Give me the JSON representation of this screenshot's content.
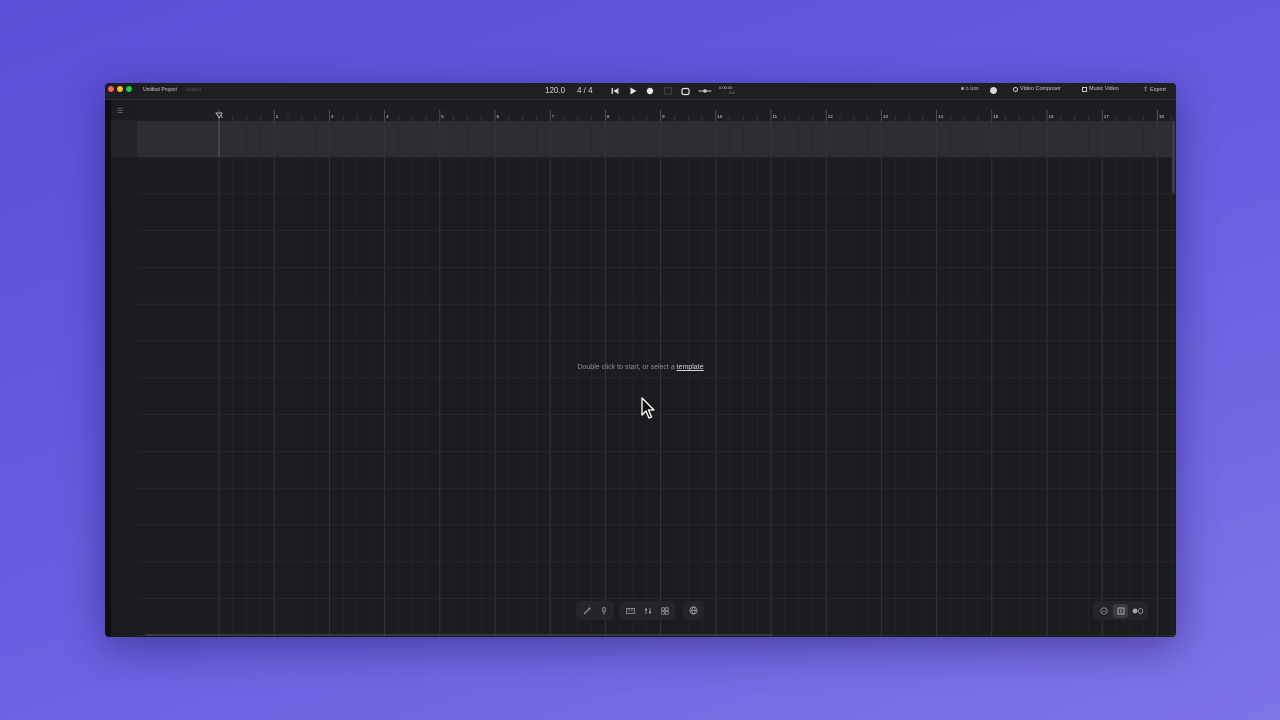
{
  "window": {
    "title": "Untitled Project",
    "subtitle": "Untitled"
  },
  "transport": {
    "tempo": "120.0",
    "time_signature": "4 / 4",
    "time_main": "0:00:00",
    "time_sub": "000",
    "icons": [
      "skip-back-icon",
      "play-icon",
      "record-icon",
      "metronome-icon",
      "loop-icon",
      "input-icon"
    ]
  },
  "header_right": {
    "status": "0 /100",
    "video_composer": "Video Composer",
    "music_video": "Music Video",
    "export": "Export"
  },
  "ruler": {
    "bars": [
      "1",
      "2",
      "3",
      "4",
      "5",
      "6",
      "7",
      "8",
      "9",
      "10",
      "11",
      "12",
      "13",
      "14",
      "15",
      "16",
      "17",
      "18"
    ]
  },
  "canvas": {
    "hint_prefix": "Double click to start, or select a",
    "hint_link": "template"
  },
  "bottom_toolbar": {
    "groups": [
      [
        "magic-wand-icon",
        "microphone-icon"
      ],
      [
        "keyboard-icon",
        "mixer-icon",
        "drum-pad-icon"
      ],
      [
        "globe-icon"
      ]
    ]
  },
  "bottom_right": {
    "icons": [
      "zoom-out-icon",
      "zoom-fit-icon",
      "snap-toggle-icon"
    ]
  },
  "colors": {
    "background": "#5a4fd6",
    "window": "#1b1c20",
    "track_lane": "#2d2e33"
  }
}
